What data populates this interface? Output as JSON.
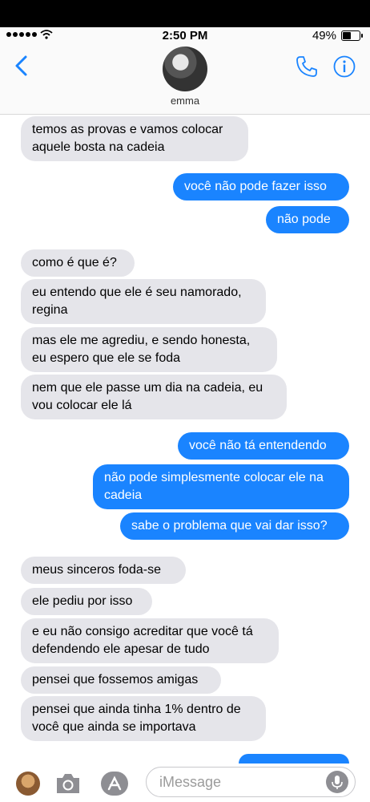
{
  "status_bar": {
    "time": "2:50 PM",
    "battery": "49%",
    "battery_level": 0.49
  },
  "header": {
    "contact_name": "emma"
  },
  "messages": [
    {
      "dir": "in",
      "text": "temos as provas e vamos colocar\naquele bosta na cadeia"
    },
    {
      "dir": "out",
      "text": "você não pode fazer isso"
    },
    {
      "dir": "out",
      "text": "não pode"
    },
    {
      "dir": "in",
      "text": "como é que é?"
    },
    {
      "dir": "in",
      "text": "eu entendo que ele é seu namorado,\nregina"
    },
    {
      "dir": "in",
      "text": "mas ele me agrediu, e sendo honesta,\neu espero que ele se foda"
    },
    {
      "dir": "in",
      "text": "nem que ele passe um dia na cadeia, eu\nvou colocar ele lá"
    },
    {
      "dir": "out",
      "text": "você não tá entendendo"
    },
    {
      "dir": "out",
      "text": "não pode simplesmente colocar ele na\ncadeia"
    },
    {
      "dir": "out",
      "text": "sabe o problema que vai dar isso?"
    },
    {
      "dir": "in",
      "text": "meus sinceros foda-se"
    },
    {
      "dir": "in",
      "text": "ele pediu por isso"
    },
    {
      "dir": "in",
      "text": "e eu não consigo acreditar que você tá\ndefendendo ele apesar de tudo"
    },
    {
      "dir": "in",
      "text": "pensei que fossemos amigas"
    },
    {
      "dir": "in",
      "text": "pensei que ainda tinha 1% dentro de\nvocê que ainda se importava"
    }
  ],
  "composer": {
    "placeholder": "iMessage"
  },
  "colors": {
    "incoming": "#e5e5ea",
    "outgoing": "#1a84ff",
    "accent": "#1a84ff"
  },
  "icons": [
    "back-chevron-icon",
    "phone-icon",
    "info-icon",
    "camera-icon",
    "app-store-icon",
    "microphone-icon"
  ]
}
